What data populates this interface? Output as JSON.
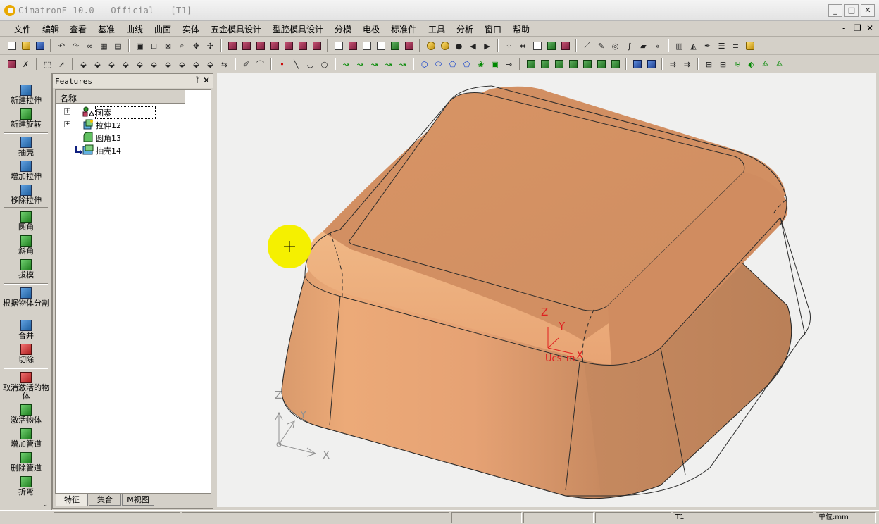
{
  "window": {
    "title": "CimatronE 10.0 - Official - [T1]",
    "minimize": "_",
    "maximize": "□",
    "close": "✕"
  },
  "menu": {
    "items": [
      "文件",
      "编辑",
      "查看",
      "基准",
      "曲线",
      "曲面",
      "实体",
      "五金模具设计",
      "型腔模具设计",
      "分模",
      "电极",
      "标准件",
      "工具",
      "分析",
      "窗口",
      "帮助"
    ],
    "mdi_min": "-",
    "mdi_restore": "❐",
    "mdi_close": "✕"
  },
  "leftbar": {
    "buttons": [
      "新建拉伸",
      "新建旋转",
      "抽壳",
      "增加拉伸",
      "移除拉伸",
      "圆角",
      "斜角",
      "拔模",
      "根据物体分割",
      "合并",
      "切除",
      "取消激活的物体",
      "激活物体",
      "增加管道",
      "删除管道",
      "折弯"
    ],
    "scroll": "⌄"
  },
  "panel": {
    "title": "Features",
    "pin": "ᛘ",
    "close": "✕",
    "column": "名称",
    "tree": [
      {
        "label": "图素",
        "expander": "+"
      },
      {
        "label": "拉伸12",
        "expander": "+"
      },
      {
        "label": "圆角13",
        "expander": ""
      },
      {
        "label": "抽壳14",
        "expander": ""
      }
    ],
    "tabs": [
      "特征",
      "集合",
      "M视图"
    ]
  },
  "viewport": {
    "ucs": {
      "z": "Z",
      "y": "Y",
      "x": "X",
      "name": "Ucs_m"
    },
    "axes": {
      "z": "Z",
      "y": "Y",
      "x": "X"
    },
    "colors": {
      "part": "#e8a070",
      "highlight": "#f5f000",
      "ucs": "#e02020"
    }
  },
  "status": {
    "model": "T1",
    "unit": "单位:mm"
  }
}
